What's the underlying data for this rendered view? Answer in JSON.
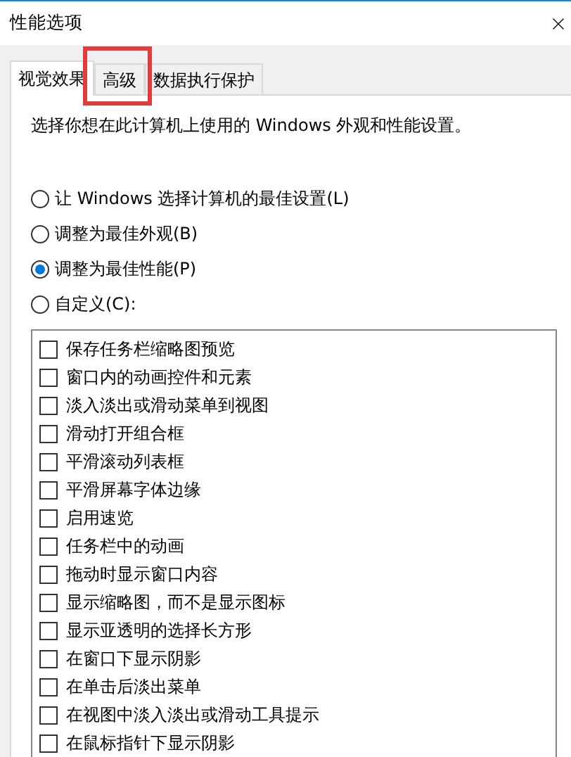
{
  "window": {
    "title": "性能选项"
  },
  "tabs": [
    {
      "label": "视觉效果",
      "selected": true
    },
    {
      "label": "高级",
      "selected": false,
      "highlighted": true
    },
    {
      "label": "数据执行保护",
      "selected": false
    }
  ],
  "description": "选择你想在此计算机上使用的 Windows 外观和性能设置。",
  "options": [
    {
      "label": "让 Windows 选择计算机的最佳设置(L)",
      "selected": false
    },
    {
      "label": "调整为最佳外观(B)",
      "selected": false
    },
    {
      "label": "调整为最佳性能(P)",
      "selected": true
    },
    {
      "label": "自定义(C):",
      "selected": false
    }
  ],
  "effects": [
    {
      "label": "保存任务栏缩略图预览",
      "checked": false
    },
    {
      "label": "窗口内的动画控件和元素",
      "checked": false
    },
    {
      "label": "淡入淡出或滑动菜单到视图",
      "checked": false
    },
    {
      "label": "滑动打开组合框",
      "checked": false
    },
    {
      "label": "平滑滚动列表框",
      "checked": false
    },
    {
      "label": "平滑屏幕字体边缘",
      "checked": false
    },
    {
      "label": "启用速览",
      "checked": false
    },
    {
      "label": "任务栏中的动画",
      "checked": false
    },
    {
      "label": "拖动时显示窗口内容",
      "checked": false
    },
    {
      "label": "显示缩略图，而不是显示图标",
      "checked": false
    },
    {
      "label": "显示亚透明的选择长方形",
      "checked": false
    },
    {
      "label": "在窗口下显示阴影",
      "checked": false
    },
    {
      "label": "在单击后淡出菜单",
      "checked": false
    },
    {
      "label": "在视图中淡入淡出或滑动工具提示",
      "checked": false
    },
    {
      "label": "在鼠标指针下显示阴影",
      "checked": false
    }
  ]
}
